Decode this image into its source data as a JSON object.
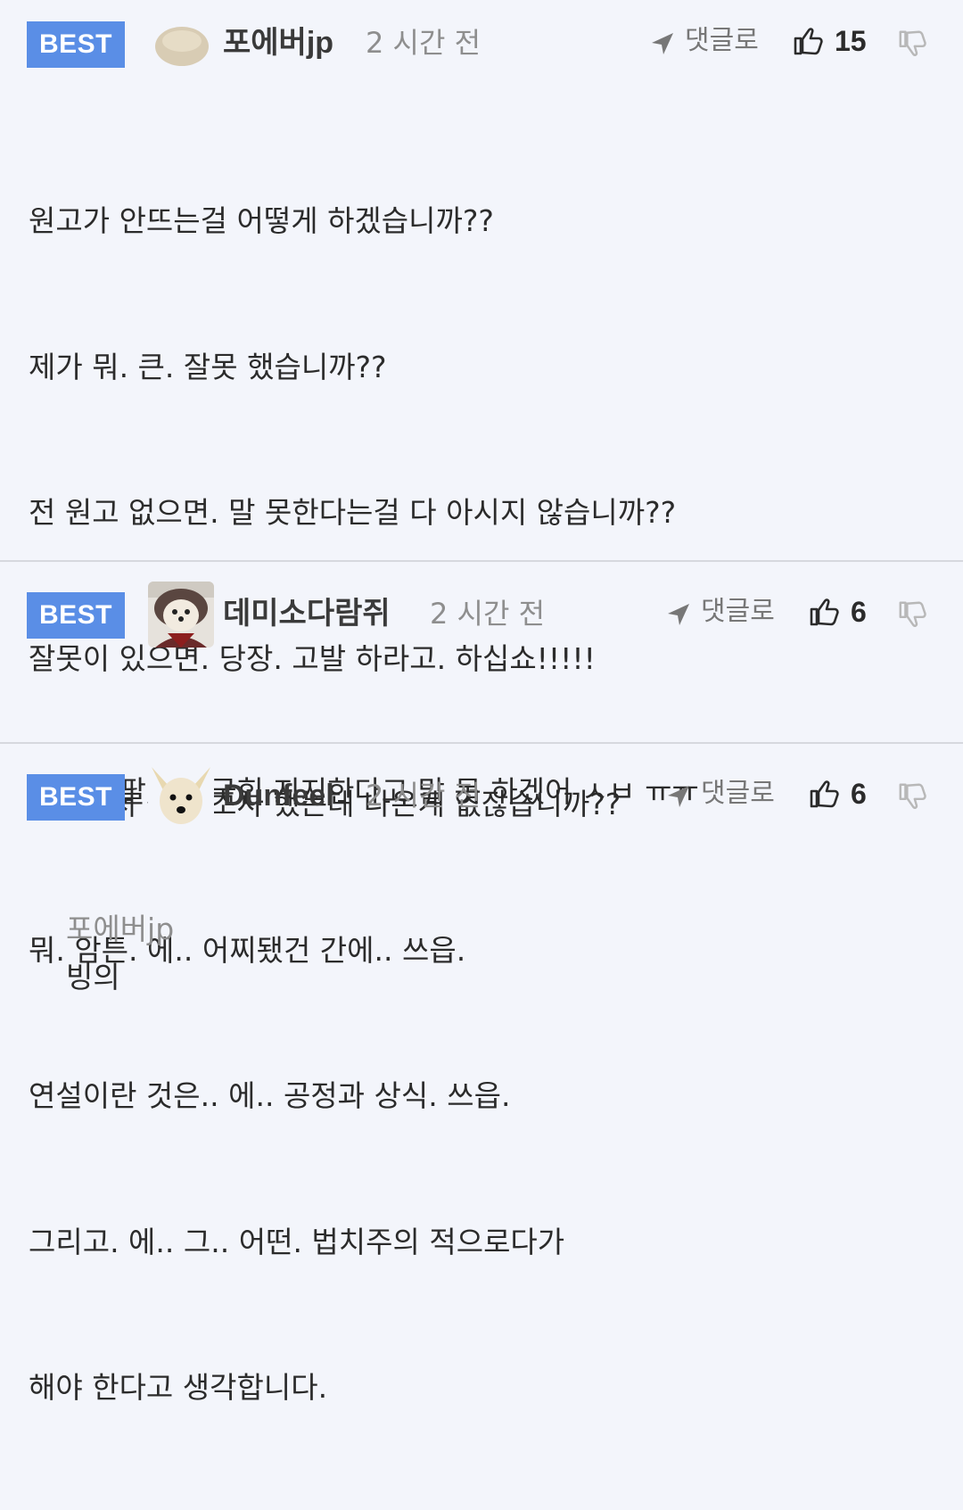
{
  "comments": [
    {
      "badge": "BEST",
      "username": "포에버jp",
      "time": "2 시간 전",
      "reply_label": "댓글로",
      "likes": "15",
      "lines": [
        "원고가 안뜨는걸 어떻게 하겠습니까??",
        "제가 뭐. 큰. 잘못 했습니까??",
        "전 원고 없으면. 말 못한다는걸 다 아시지 않습니까??",
        "잘못이 있으면. 당장. 고발 하라고. 하십쇼!!!!!",
        "검찰에서 싹다 조사 했는데 나온게 없잖습니까??",
        "뭐. 암튼. 에.. 어찌됐건 간에.. 쓰읍.",
        "연설이란 것은.. 에.. 공정과 상식. 쓰읍.",
        "그리고. 에.. 그.. 어떤. 법치주의 적으로다가",
        "해야 한다고 생각합니다."
      ]
    },
    {
      "badge": "BEST",
      "username": "데미소다람쥐",
      "time": "2 시간 전",
      "reply_label": "댓글로",
      "likes": "6",
      "lines": [
        "진짜 쪽팔려서 국힘 지지한다고 말 못 하겠어 ㅅㅂ ㅠㅠ"
      ]
    },
    {
      "badge": "BEST",
      "username": "Dunfeel",
      "time": "2 시간 전",
      "reply_label": "댓글로",
      "likes": "6",
      "mention": "포에버jp",
      "text": "빙의"
    }
  ],
  "colors": {
    "background": "#f3f5fb",
    "badge": "#5a8ee6",
    "separator": "#d6d8de",
    "muted": "#8e8e8e"
  },
  "icons": {
    "reply": "send-arrow-icon",
    "like": "thumbs-up-icon",
    "dislike": "thumbs-down-icon"
  }
}
